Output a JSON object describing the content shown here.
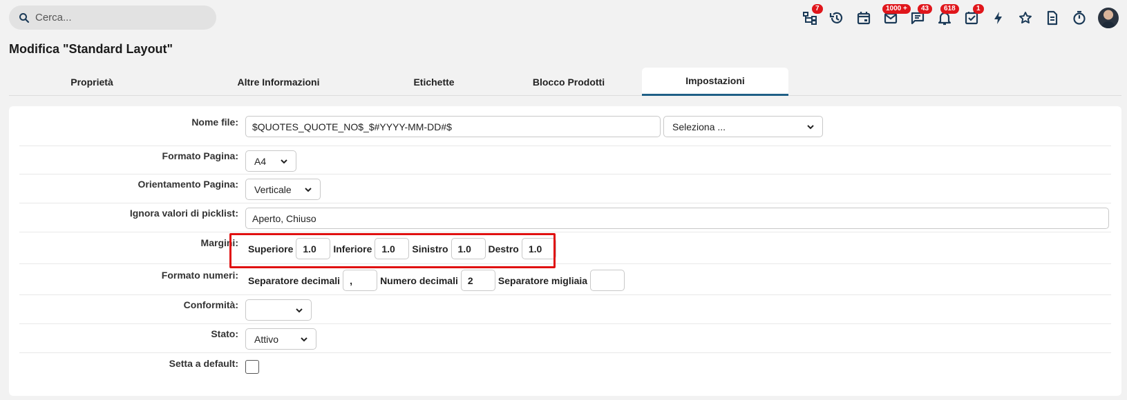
{
  "search": {
    "placeholder": "Cerca..."
  },
  "toolbar_icons": [
    {
      "name": "org-chart-icon",
      "badge": "7"
    },
    {
      "name": "history-icon",
      "badge": ""
    },
    {
      "name": "calendar-icon",
      "badge": ""
    },
    {
      "name": "mail-icon",
      "badge": "1000 +"
    },
    {
      "name": "chat-icon",
      "badge": "43"
    },
    {
      "name": "bell-icon",
      "badge": "618"
    },
    {
      "name": "task-check-icon",
      "badge": "1"
    },
    {
      "name": "lightning-icon",
      "badge": ""
    },
    {
      "name": "star-icon",
      "badge": ""
    },
    {
      "name": "document-icon",
      "badge": ""
    },
    {
      "name": "timer-icon",
      "badge": ""
    }
  ],
  "page_title": "Modifica \"Standard Layout\"",
  "tabs": [
    {
      "label": "Proprietà"
    },
    {
      "label": "Altre Informazioni"
    },
    {
      "label": "Etichette"
    },
    {
      "label": "Blocco Prodotti"
    },
    {
      "label": "Impostazioni"
    }
  ],
  "form": {
    "nome_file": {
      "label": "Nome file:",
      "value": "$QUOTES_QUOTE_NO$_$#YYYY-MM-DD#$",
      "select": "Seleziona ..."
    },
    "formato_pagina": {
      "label": "Formato Pagina:",
      "value": "A4"
    },
    "orientamento": {
      "label": "Orientamento Pagina:",
      "value": "Verticale"
    },
    "ignora": {
      "label": "Ignora valori di picklist:",
      "value": "Aperto, Chiuso"
    },
    "margini": {
      "label": "Margini:",
      "superiore_label": "Superiore",
      "superiore": "1.0",
      "inferiore_label": "Inferiore",
      "inferiore": "1.0",
      "sinistro_label": "Sinistro",
      "sinistro": "1.0",
      "destro_label": "Destro",
      "destro": "1.0"
    },
    "formato_numeri": {
      "label": "Formato numeri:",
      "sep_dec_label": "Separatore decimali",
      "sep_dec": ",",
      "num_dec_label": "Numero decimali",
      "num_dec": "2",
      "sep_mig_label": "Separatore migliaia",
      "sep_mig": ""
    },
    "conformita": {
      "label": "Conformità:",
      "value": ""
    },
    "stato": {
      "label": "Stato:",
      "value": "Attivo"
    },
    "default": {
      "label": "Setta a default:",
      "checked": false
    }
  },
  "colors": {
    "accent": "#1f5f86",
    "badge": "#e0161b",
    "highlight": "#e01010",
    "icon": "#1b3a57"
  }
}
